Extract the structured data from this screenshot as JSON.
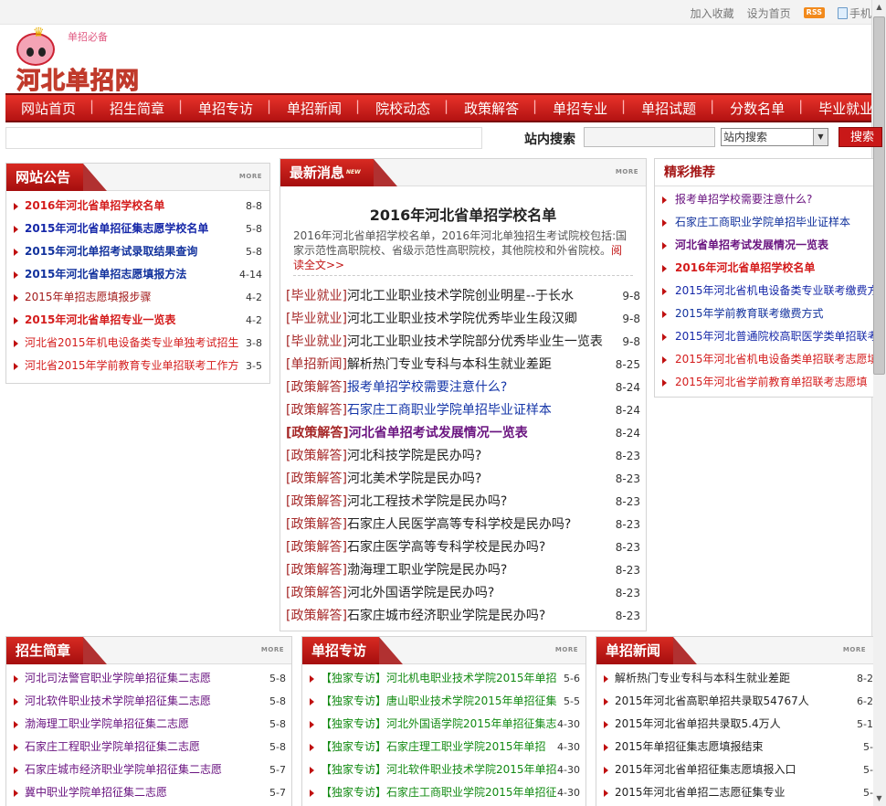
{
  "toplinks": {
    "bookmark": "加入收藏",
    "homepage": "设为首页",
    "rss": "RSS",
    "mobile": "手机"
  },
  "logo": {
    "small": "单招必备",
    "big": "河北单招网"
  },
  "nav": [
    "网站首页",
    "招生简章",
    "单招专访",
    "单招新闻",
    "院校动态",
    "政策解答",
    "单招专业",
    "单招试题",
    "分数名单",
    "毕业就业"
  ],
  "search": {
    "label": "站内搜索",
    "select_value": "站内搜索",
    "button": "搜索",
    "input_value": ""
  },
  "notice": {
    "title": "网站公告",
    "more": "MORE",
    "items": [
      {
        "text": "2016年河北省单招学校名单",
        "date": "8-8"
      },
      {
        "text": "2015年河北省单招征集志愿学校名单",
        "date": "5-8"
      },
      {
        "text": "2015年河北单招考试录取结果查询",
        "date": "5-8"
      },
      {
        "text": "2015年河北省单招志愿填报方法",
        "date": "4-14"
      },
      {
        "text": "2015年单招志愿填报步骤",
        "date": "4-2"
      },
      {
        "text": "2015年河北省单招专业一览表",
        "date": "4-2"
      },
      {
        "text": "河北省2015年机电设备类专业单独考试招生",
        "date": "3-8"
      },
      {
        "text": "河北省2015年学前教育专业单招联考工作方",
        "date": "3-5"
      }
    ]
  },
  "latest": {
    "title": "最新消息",
    "badge": "NEW",
    "more": "MORE",
    "headline": "2016年河北省单招学校名单",
    "summary": "2016年河北省单招学校名单，2016年河北单独招生考试院校包括:国家示范性高职院校、省级示范性高职院校，其他院校和外省院校。",
    "read_more": "阅读全文>>",
    "items": [
      {
        "cat": "[毕业就业]",
        "text": "河北工业职业技术学院创业明星--于长水",
        "date": "9-8"
      },
      {
        "cat": "[毕业就业]",
        "text": "河北工业职业技术学院优秀毕业生段汉卿",
        "date": "9-8"
      },
      {
        "cat": "[毕业就业]",
        "text": "河北工业职业技术学院部分优秀毕业生一览表",
        "date": "9-8"
      },
      {
        "cat": "[单招新闻]",
        "text": "解析热门专业专科与本科生就业差距",
        "date": "8-25"
      },
      {
        "cat": "[政策解答]",
        "text": "报考单招学校需要注意什么?",
        "date": "8-24"
      },
      {
        "cat": "[政策解答]",
        "text": "石家庄工商职业学院单招毕业证样本",
        "date": "8-24"
      },
      {
        "cat": "[政策解答]",
        "text": "河北省单招考试发展情况一览表",
        "date": "8-24"
      },
      {
        "cat": "[政策解答]",
        "text": "河北科技学院是民办吗?",
        "date": "8-23"
      },
      {
        "cat": "[政策解答]",
        "text": "河北美术学院是民办吗?",
        "date": "8-23"
      },
      {
        "cat": "[政策解答]",
        "text": "河北工程技术学院是民办吗?",
        "date": "8-23"
      },
      {
        "cat": "[政策解答]",
        "text": "石家庄人民医学高等专科学校是民办吗?",
        "date": "8-23"
      },
      {
        "cat": "[政策解答]",
        "text": "石家庄医学高等专科学校是民办吗?",
        "date": "8-23"
      },
      {
        "cat": "[政策解答]",
        "text": "渤海理工职业学院是民办吗?",
        "date": "8-23"
      },
      {
        "cat": "[政策解答]",
        "text": "河北外国语学院是民办吗?",
        "date": "8-23"
      },
      {
        "cat": "[政策解答]",
        "text": "石家庄城市经济职业学院是民办吗?",
        "date": "8-23"
      }
    ]
  },
  "featured": {
    "title": "精彩推荐",
    "items": [
      "报考单招学校需要注意什么?",
      "石家庄工商职业学院单招毕业证样本",
      "河北省单招考试发展情况一览表",
      "2016年河北省单招学校名单",
      "2015年河北省机电设备类专业联考缴费方",
      "2015年学前教育联考缴费方式",
      "2015年河北普通院校高职医学类单招联考",
      "2015年河北省机电设备类单招联考志愿填",
      "2015年河北省学前教育单招联考志愿填"
    ]
  },
  "brochure": {
    "title": "招生简章",
    "more": "MORE",
    "items": [
      {
        "text": "河北司法警官职业学院单招征集二志愿",
        "date": "5-8"
      },
      {
        "text": "河北软件职业技术学院单招征集二志愿",
        "date": "5-8"
      },
      {
        "text": "渤海理工职业学院单招征集二志愿",
        "date": "5-8"
      },
      {
        "text": "石家庄工程职业学院单招征集二志愿",
        "date": "5-8"
      },
      {
        "text": "石家庄城市经济职业学院单招征集二志愿",
        "date": "5-7"
      },
      {
        "text": "冀中职业学院单招征集二志愿",
        "date": "5-7"
      }
    ]
  },
  "interview": {
    "title": "单招专访",
    "more": "MORE",
    "items": [
      {
        "tag": "【独家专访】",
        "text": "河北机电职业技术学院2015年单招",
        "date": "5-6"
      },
      {
        "tag": "【独家专访】",
        "text": "唐山职业技术学院2015年单招征集",
        "date": "5-5"
      },
      {
        "tag": "【独家专访】",
        "text": "河北外国语学院2015年单招征集志",
        "date": "4-30"
      },
      {
        "tag": "【独家专访】",
        "text": "石家庄理工职业学院2015年单招",
        "date": "4-30"
      },
      {
        "tag": "【独家专访】",
        "text": "河北软件职业技术学院2015年单招",
        "date": "4-30"
      },
      {
        "tag": "【独家专访】",
        "text": "石家庄工商职业学院2015年单招征",
        "date": "4-30"
      }
    ]
  },
  "news": {
    "title": "单招新闻",
    "more": "MORE",
    "items": [
      {
        "text": "解析热门专业专科与本科生就业差距",
        "date": "8-2"
      },
      {
        "text": "2015年河北省高职单招共录取54767人",
        "date": "6-2"
      },
      {
        "text": "2015年河北省单招共录取5.4万人",
        "date": "5-1"
      },
      {
        "text": "2015年单招征集志愿填报结束",
        "date": "5-"
      },
      {
        "text": "2015年河北省单招征集志愿填报入口",
        "date": "5-"
      },
      {
        "text": "2015年河北省单招二志愿征集专业",
        "date": "5-"
      }
    ]
  }
}
